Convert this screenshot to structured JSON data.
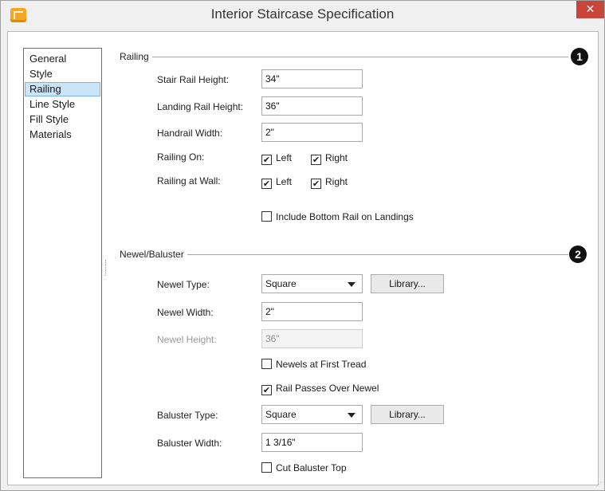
{
  "window": {
    "title": "Interior Staircase Specification",
    "close_glyph": "✕"
  },
  "nav": {
    "items": [
      {
        "label": "General"
      },
      {
        "label": "Style"
      },
      {
        "label": "Railing"
      },
      {
        "label": "Line Style"
      },
      {
        "label": "Fill Style"
      },
      {
        "label": "Materials"
      }
    ],
    "selected": "Railing"
  },
  "railing": {
    "section_label": "Railing",
    "badge": "1",
    "stair_rail_height_label": "Stair Rail Height:",
    "stair_rail_height_value": "34\"",
    "landing_rail_height_label": "Landing Rail Height:",
    "landing_rail_height_value": "36\"",
    "handrail_width_label": "Handrail Width:",
    "handrail_width_value": "2\"",
    "railing_on_label": "Railing On:",
    "railing_on_left": "Left",
    "railing_on_right": "Right",
    "railing_at_wall_label": "Railing at Wall:",
    "railing_at_wall_left": "Left",
    "railing_at_wall_right": "Right",
    "include_bottom_rail_label": "Include Bottom Rail on Landings"
  },
  "newel": {
    "section_label": "Newel/Baluster",
    "badge": "2",
    "newel_type_label": "Newel Type:",
    "newel_type_value": "Square",
    "library_label": "Library...",
    "newel_width_label": "Newel Width:",
    "newel_width_value": "2\"",
    "newel_height_label": "Newel Height:",
    "newel_height_value": "36\"",
    "newels_at_first_tread_label": "Newels at First Tread",
    "rail_passes_over_newel_label": "Rail Passes Over Newel",
    "baluster_type_label": "Baluster Type:",
    "baluster_type_value": "Square",
    "baluster_library_label": "Library...",
    "baluster_width_label": "Baluster Width:",
    "baluster_width_value": "1 3/16\"",
    "cut_baluster_top_label": "Cut Baluster Top"
  },
  "checks": {
    "railing_on_left": true,
    "railing_on_right": true,
    "railing_at_wall_left": true,
    "railing_at_wall_right": true,
    "include_bottom_rail": false,
    "newels_at_first_tread": false,
    "rail_passes_over_newel": true,
    "cut_baluster_top": false
  },
  "check_glyph": "✔",
  "colors": {
    "close_button": "#c7463b",
    "selection_bg": "#cce4f7",
    "app_icon": "#f5a623"
  }
}
